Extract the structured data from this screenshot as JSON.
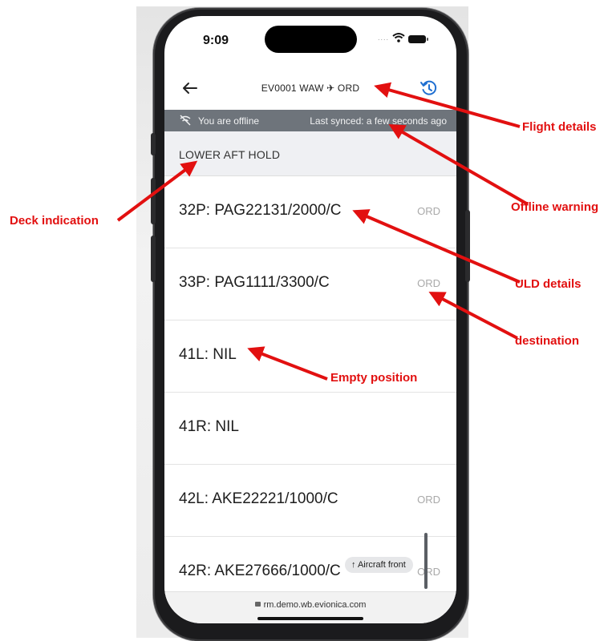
{
  "status_bar": {
    "time": "9:09",
    "signal": "....",
    "wifi_icon": "wifi-icon",
    "battery_icon": "battery-icon"
  },
  "header": {
    "back_icon": "back-arrow-icon",
    "title": "EV0001 WAW ✈ ORD",
    "history_icon": "history-icon"
  },
  "offline_bar": {
    "icon": "offline-icon",
    "message": "You are offline",
    "synced": "Last synced: a few seconds ago"
  },
  "deck": {
    "label": "LOWER AFT HOLD"
  },
  "ulds": [
    {
      "label": "32P: PAG22131/2000/C",
      "destination": "ORD"
    },
    {
      "label": "33P: PAG1111/3300/C",
      "destination": "ORD"
    },
    {
      "label": "41L: NIL",
      "destination": ""
    },
    {
      "label": "41R: NIL",
      "destination": ""
    },
    {
      "label": "42L: AKE22221/1000/C",
      "destination": "ORD"
    },
    {
      "label": "42R: AKE27666/1000/C",
      "destination": "ORD"
    }
  ],
  "aircraft_front_button": {
    "label": "↑ Aircraft front"
  },
  "url_bar": {
    "url": "rm.demo.wb.evionica.com"
  },
  "annotations": {
    "flight_details": "Flight details",
    "offline_warning": "Offline warning",
    "deck_indication": "Deck indication",
    "uld_details": "ULD details",
    "destination": "destination",
    "empty_position": "Empty position"
  },
  "colors": {
    "callout": "#e21010",
    "accent": "#1f6fd1",
    "offline_bar": "#6e747b",
    "deck_header": "#eff0f3"
  }
}
